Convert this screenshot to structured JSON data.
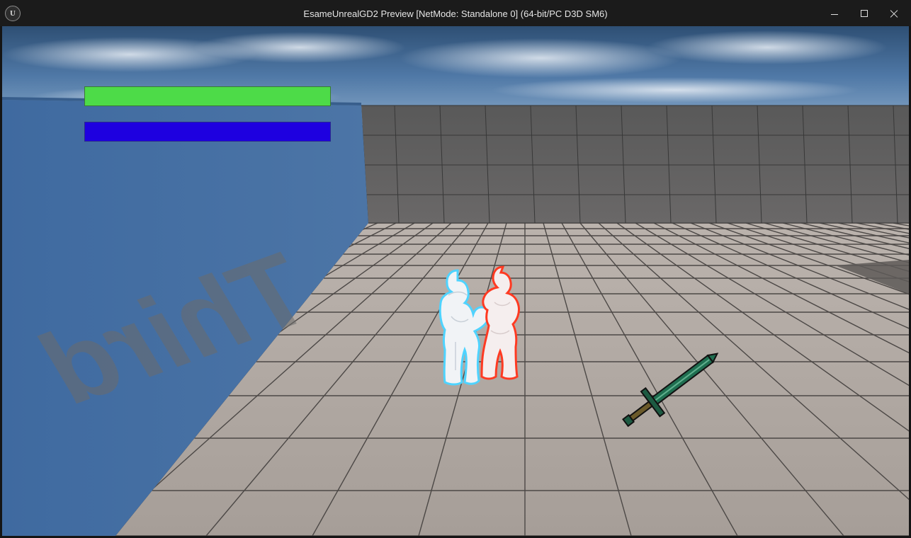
{
  "window": {
    "title": "EsameUnrealGD2 Preview [NetMode: Standalone 0]  (64-bit/PC D3D SM6)",
    "logo_text": "U",
    "buttons": [
      "minimize",
      "maximize",
      "close"
    ]
  },
  "hud": {
    "health": {
      "fraction": 1.0,
      "color": "#4ddb48"
    },
    "stamina": {
      "fraction": 1.0,
      "color": "#1e00e0"
    }
  },
  "scene": {
    "wall_text": "Third",
    "player_outline_color": "#4fd3ff",
    "enemy_outline_color": "#ff3a22",
    "pickup": "sword-pickup",
    "sword_color": "#1f6e50"
  }
}
